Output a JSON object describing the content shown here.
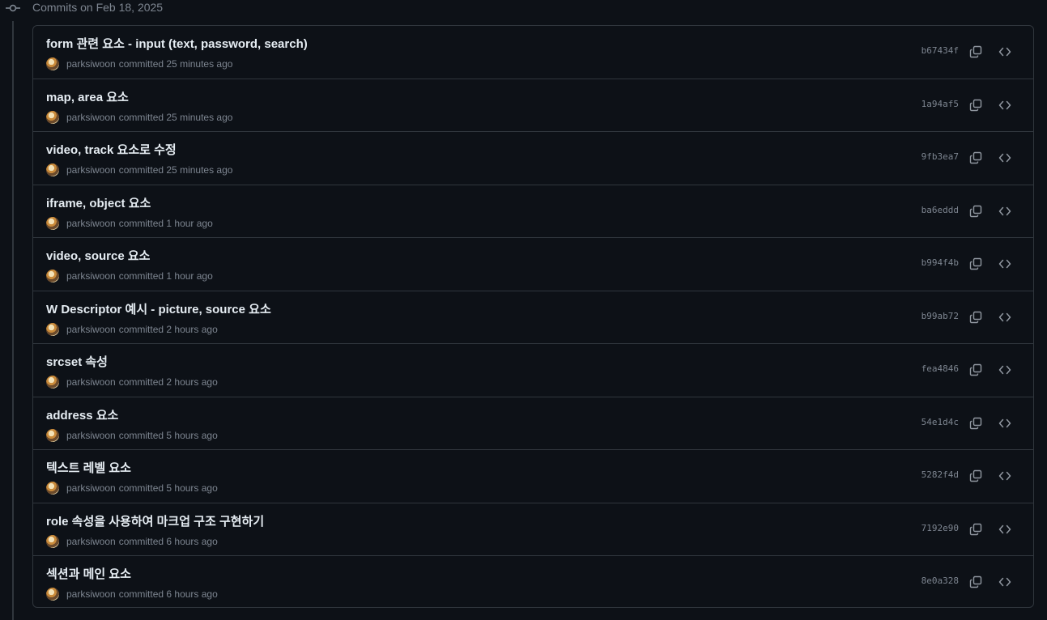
{
  "group": {
    "title": "Commits on Feb 18, 2025",
    "icon": "git-commit-icon"
  },
  "commits": [
    {
      "title": "form 관련 요소 - input (text, password, search)",
      "author": "parksiwoon",
      "time": "committed 25 minutes ago",
      "sha": "b67434f"
    },
    {
      "title": "map, area 요소",
      "author": "parksiwoon",
      "time": "committed 25 minutes ago",
      "sha": "1a94af5"
    },
    {
      "title": "video, track 요소로 수정",
      "author": "parksiwoon",
      "time": "committed 25 minutes ago",
      "sha": "9fb3ea7"
    },
    {
      "title": "iframe, object 요소",
      "author": "parksiwoon",
      "time": "committed 1 hour ago",
      "sha": "ba6eddd"
    },
    {
      "title": "video, source 요소",
      "author": "parksiwoon",
      "time": "committed 1 hour ago",
      "sha": "b994f4b"
    },
    {
      "title": "W Descriptor 예시 - picture, source 요소",
      "author": "parksiwoon",
      "time": "committed 2 hours ago",
      "sha": "b99ab72"
    },
    {
      "title": "srcset 속성",
      "author": "parksiwoon",
      "time": "committed 2 hours ago",
      "sha": "fea4846"
    },
    {
      "title": "address 요소",
      "author": "parksiwoon",
      "time": "committed 5 hours ago",
      "sha": "54e1d4c"
    },
    {
      "title": "텍스트 레벨 요소",
      "author": "parksiwoon",
      "time": "committed 5 hours ago",
      "sha": "5282f4d"
    },
    {
      "title": "role 속성을 사용하여 마크업 구조 구현하기",
      "author": "parksiwoon",
      "time": "committed 6 hours ago",
      "sha": "7192e90"
    },
    {
      "title": "섹션과 메인 요소",
      "author": "parksiwoon",
      "time": "committed 6 hours ago",
      "sha": "8e0a328"
    }
  ],
  "colors": {
    "background": "#0d1117",
    "border": "#30363d",
    "muted_text": "#7d8590",
    "primary_text": "#e6edf3"
  },
  "icons": {
    "copy": "copy-icon",
    "browse": "code-browse-icon"
  }
}
